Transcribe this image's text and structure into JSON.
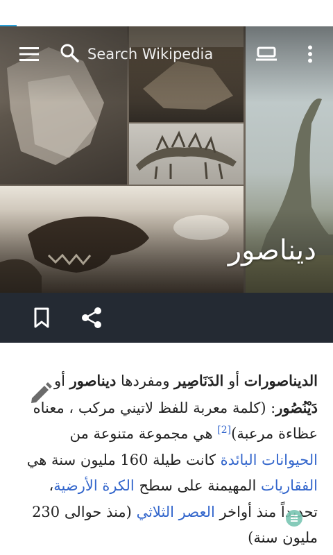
{
  "toolbar": {
    "search_placeholder": "Search Wikipedia",
    "menu_icon": "menu-icon",
    "search_icon": "search-icon",
    "reading_list_icon": "reading-list-icon",
    "overflow_icon": "more-vertical-icon"
  },
  "article": {
    "title": "ديناصور",
    "lead": {
      "s1_bold": "الديناصورات",
      "s1_or": " أو ",
      "s1_bold2": "الدَنَاصِير",
      "s1_rest": " ومفردها ",
      "s2_bold": "ديناصور",
      "s2_or": " أو ",
      "s2_bold2": "دَيْنُصُور",
      "s2_rest": ": (كلمة معربة للفظ لاتيني مركب ، معناه عظاءة مرعبة)",
      "ref": "[2]",
      "s3": " هي مجموعة متنوعة من ",
      "link1": "الحيوانات البائدة",
      "s4": " كانت طيلة 160 مليون سنة هي ",
      "link2": "الفقاريات",
      "s5": " المهيمنة على سطح ",
      "link3": "الكرة الأرضية",
      "s6": "، تحديداً منذ أواخر ",
      "link4": "العصر الثلاثي",
      "s7": " (منذ حوالى 230 مليون سنة)"
    }
  },
  "actions": {
    "bookmark_icon": "bookmark-icon",
    "share_icon": "share-icon",
    "edit_icon": "edit-pencil-icon"
  },
  "colors": {
    "link": "#3366cc",
    "actionbar": "#242a33",
    "accent": "#2a9fd6"
  }
}
